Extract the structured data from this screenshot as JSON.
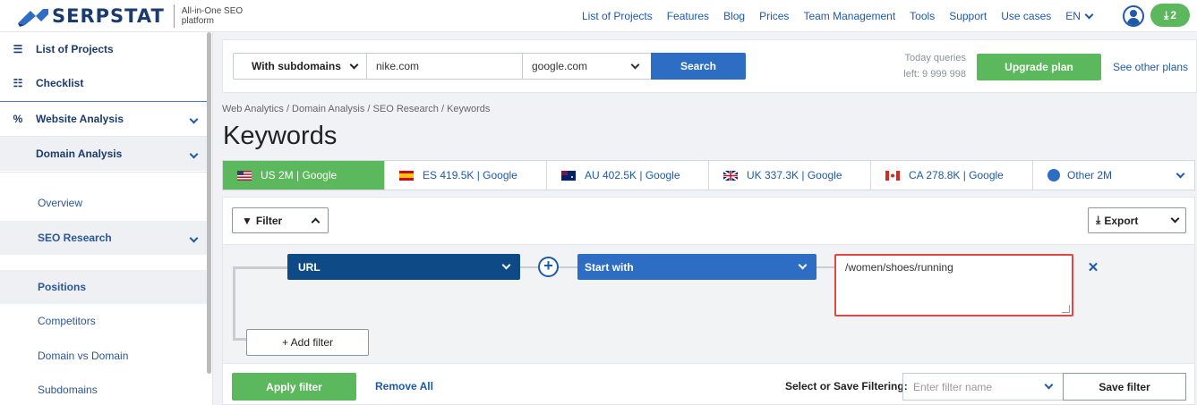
{
  "header": {
    "logo_text": "SERPSTAT",
    "tagline": "All-in-One SEO platform",
    "nav": [
      "List of Projects",
      "Features",
      "Blog",
      "Prices",
      "Team Management",
      "Tools",
      "Support",
      "Use cases"
    ],
    "lang": "EN",
    "download_count": "2",
    "colors": {
      "brand": "#1a3b6e",
      "link": "#1e5aa8",
      "green": "#5cb85c"
    }
  },
  "sidebar": {
    "items": [
      {
        "label": "List of Projects",
        "icon": "menu-icon"
      },
      {
        "label": "Checklist",
        "icon": "checklist-icon"
      },
      {
        "label": "Website Analysis",
        "icon": "analytics-icon"
      },
      {
        "label": "Domain Analysis"
      },
      {
        "label": "Overview"
      },
      {
        "label": "SEO Research"
      },
      {
        "label": "Positions"
      },
      {
        "label": "Competitors"
      },
      {
        "label": "Domain vs Domain"
      },
      {
        "label": "Subdomains"
      }
    ]
  },
  "search": {
    "subdomain_select": "With subdomains",
    "domain_value": "nike.com",
    "engine_select": "google.com",
    "search_label": "Search",
    "queries_label": "Today queries",
    "queries_left": "left: 9 999 998",
    "upgrade_label": "Upgrade plan",
    "plans_link": "See other plans"
  },
  "breadcrumb": "Web Analytics / Domain Analysis / SEO Research / Keywords",
  "page_title": "Keywords",
  "db_tabs": [
    {
      "label": "US 2M | Google",
      "flag": "us-flag-icon"
    },
    {
      "label": "ES 419.5K | Google",
      "flag": "es-flag-icon"
    },
    {
      "label": "AU 402.5K | Google",
      "flag": "au-flag-icon"
    },
    {
      "label": "UK 337.3K | Google",
      "flag": "uk-flag-icon"
    },
    {
      "label": "CA 278.8K | Google",
      "flag": "ca-flag-icon"
    },
    {
      "label": "Other 2M",
      "flag": "globe-icon"
    }
  ],
  "filter": {
    "filter_label": "Filter",
    "export_label": "Export",
    "field_select": "URL",
    "operator_select": "Start with",
    "value": "/women/shoes/running",
    "add_filter_label": "+ Add filter",
    "apply_label": "Apply filter",
    "remove_all_label": "Remove All",
    "save_filtering_label": "Select or Save Filtering:",
    "filter_name_placeholder": "Enter filter name",
    "save_filter_label": "Save filter"
  }
}
